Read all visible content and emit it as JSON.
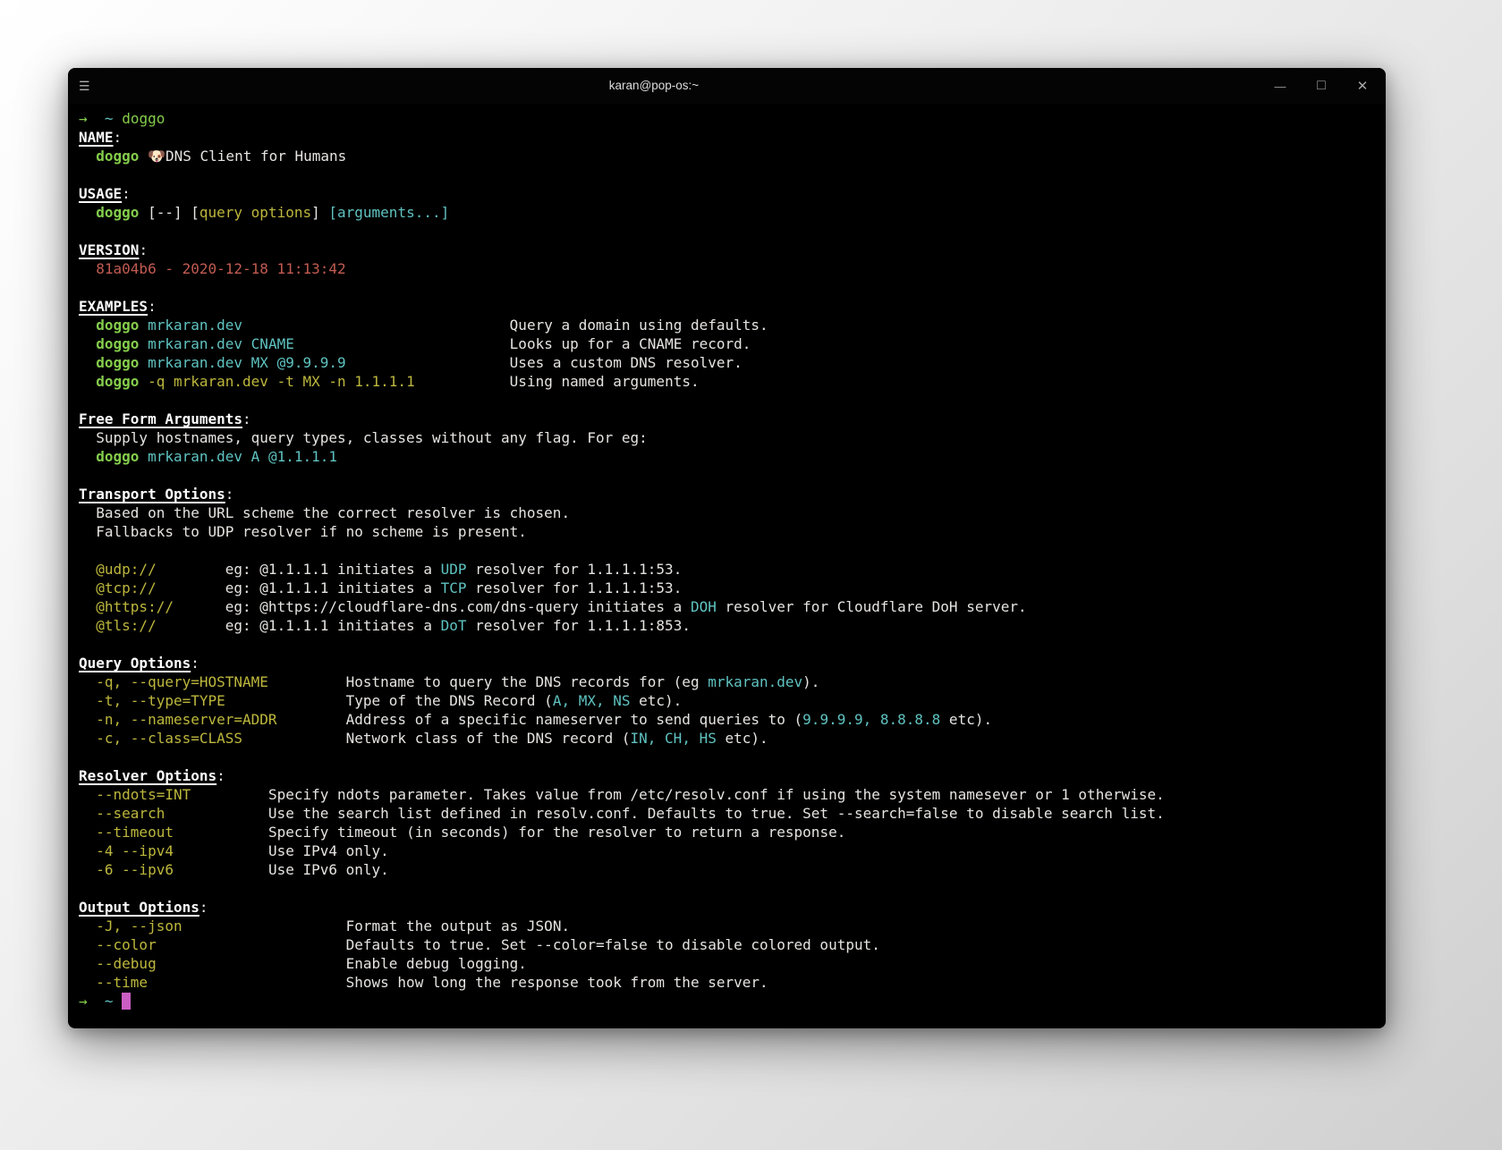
{
  "window": {
    "title": "karan@pop-os:~",
    "menu_icon": "☰",
    "minimize_icon": "—",
    "maximize_icon": "□",
    "close_icon": "✕"
  },
  "colors": {
    "terminal_bg": "#000000",
    "titlebar_bg": "#040404",
    "fg": "#e6e4e1",
    "header": "#fcfcfc",
    "green": "#84cc4c",
    "cyan": "#5fc3c1",
    "yellow": "#bdb73d",
    "red": "#c25b52",
    "magenta": "#cb5ec3"
  },
  "terminal": {
    "lines": [
      [
        [
          "→",
          "g"
        ],
        [
          "  ",
          ""
        ],
        [
          "~",
          "c"
        ],
        [
          " ",
          ""
        ],
        [
          "doggo",
          "g"
        ]
      ],
      [
        [
          "NAME",
          "h"
        ],
        [
          ":",
          ""
        ]
      ],
      [
        [
          "  ",
          ""
        ],
        [
          "doggo",
          "gb"
        ],
        [
          " ",
          ""
        ],
        [
          "🐶",
          "e"
        ],
        [
          "DNS Client for Humans",
          ""
        ]
      ],
      [],
      [
        [
          "USAGE",
          "h"
        ],
        [
          ":",
          ""
        ]
      ],
      [
        [
          "  ",
          ""
        ],
        [
          "doggo",
          "gb"
        ],
        [
          " [--] [",
          ""
        ],
        [
          "query options",
          "y"
        ],
        [
          "] ",
          ""
        ],
        [
          "[arguments...]",
          "c"
        ]
      ],
      [],
      [
        [
          "VERSION",
          "h"
        ],
        [
          ":",
          ""
        ]
      ],
      [
        [
          "  81a04b6 - 2020-12-18 11:13:42",
          "r"
        ]
      ],
      [],
      [
        [
          "EXAMPLES",
          "h"
        ],
        [
          ":",
          ""
        ]
      ],
      [
        [
          "  ",
          ""
        ],
        [
          "doggo",
          "gb"
        ],
        [
          " ",
          ""
        ],
        [
          "mrkaran.dev",
          "c"
        ],
        [
          "                               ",
          ""
        ],
        [
          "Query a domain using defaults.",
          ""
        ]
      ],
      [
        [
          "  ",
          ""
        ],
        [
          "doggo",
          "gb"
        ],
        [
          " ",
          ""
        ],
        [
          "mrkaran.dev CNAME",
          "c"
        ],
        [
          "                         ",
          ""
        ],
        [
          "Looks up for a CNAME record.",
          ""
        ]
      ],
      [
        [
          "  ",
          ""
        ],
        [
          "doggo",
          "gb"
        ],
        [
          " ",
          ""
        ],
        [
          "mrkaran.dev MX @9.9.9.9",
          "c"
        ],
        [
          "                   ",
          ""
        ],
        [
          "Uses a custom DNS resolver.",
          ""
        ]
      ],
      [
        [
          "  ",
          ""
        ],
        [
          "doggo",
          "gb"
        ],
        [
          " ",
          ""
        ],
        [
          "-q mrkaran.dev -t MX -n 1.1.1.1",
          "y"
        ],
        [
          "           ",
          ""
        ],
        [
          "Using named arguments.",
          ""
        ]
      ],
      [],
      [
        [
          "Free Form Arguments",
          "h"
        ],
        [
          ":",
          ""
        ]
      ],
      [
        [
          "  Supply hostnames, query types, classes without any flag. For eg:",
          ""
        ]
      ],
      [
        [
          "  ",
          ""
        ],
        [
          "doggo",
          "gb"
        ],
        [
          " ",
          ""
        ],
        [
          "mrkaran.dev A @1.1.1.1",
          "c"
        ]
      ],
      [],
      [
        [
          "Transport Options",
          "h"
        ],
        [
          ":",
          ""
        ]
      ],
      [
        [
          "  Based on the URL scheme the correct resolver is chosen.",
          ""
        ]
      ],
      [
        [
          "  Fallbacks to UDP resolver if no scheme is present.",
          ""
        ]
      ],
      [],
      [
        [
          "  ",
          ""
        ],
        [
          "@udp://",
          "y"
        ],
        [
          "        ",
          ""
        ],
        [
          "eg: @1.1.1.1 initiates a ",
          ""
        ],
        [
          "UDP",
          "c"
        ],
        [
          " resolver for 1.1.1.1:53.",
          ""
        ]
      ],
      [
        [
          "  ",
          ""
        ],
        [
          "@tcp://",
          "y"
        ],
        [
          "        ",
          ""
        ],
        [
          "eg: @1.1.1.1 initiates a ",
          ""
        ],
        [
          "TCP",
          "c"
        ],
        [
          " resolver for 1.1.1.1:53.",
          ""
        ]
      ],
      [
        [
          "  ",
          ""
        ],
        [
          "@https://",
          "y"
        ],
        [
          "      ",
          ""
        ],
        [
          "eg: @https://cloudflare-dns.com/dns-query initiates a ",
          ""
        ],
        [
          "DOH",
          "c"
        ],
        [
          " resolver for Cloudflare DoH server.",
          ""
        ]
      ],
      [
        [
          "  ",
          ""
        ],
        [
          "@tls://",
          "y"
        ],
        [
          "        ",
          ""
        ],
        [
          "eg: @1.1.1.1 initiates a ",
          ""
        ],
        [
          "DoT",
          "c"
        ],
        [
          " resolver for 1.1.1.1:853.",
          ""
        ]
      ],
      [],
      [
        [
          "Query Options",
          "h"
        ],
        [
          ":",
          ""
        ]
      ],
      [
        [
          "  ",
          ""
        ],
        [
          "-q, --query=HOSTNAME",
          "y"
        ],
        [
          "         ",
          ""
        ],
        [
          "Hostname to query the DNS records for (eg ",
          ""
        ],
        [
          "mrkaran.dev",
          "c"
        ],
        [
          ").",
          ""
        ]
      ],
      [
        [
          "  ",
          ""
        ],
        [
          "-t, --type=TYPE",
          "y"
        ],
        [
          "              ",
          ""
        ],
        [
          "Type of the DNS Record (",
          ""
        ],
        [
          "A, MX, NS",
          "c"
        ],
        [
          " etc).",
          ""
        ]
      ],
      [
        [
          "  ",
          ""
        ],
        [
          "-n, --nameserver=ADDR",
          "y"
        ],
        [
          "        ",
          ""
        ],
        [
          "Address of a specific nameserver to send queries to (",
          ""
        ],
        [
          "9.9.9.9, 8.8.8.8",
          "c"
        ],
        [
          " etc).",
          ""
        ]
      ],
      [
        [
          "  ",
          ""
        ],
        [
          "-c, --class=CLASS",
          "y"
        ],
        [
          "            ",
          ""
        ],
        [
          "Network class of the DNS record (",
          ""
        ],
        [
          "IN, CH, HS",
          "c"
        ],
        [
          " etc).",
          ""
        ]
      ],
      [],
      [
        [
          "Resolver Options",
          "h"
        ],
        [
          ":",
          ""
        ]
      ],
      [
        [
          "  ",
          ""
        ],
        [
          "--ndots=INT",
          "y"
        ],
        [
          "         ",
          ""
        ],
        [
          "Specify ndots parameter. Takes value from /etc/resolv.conf if using the system namesever or 1 otherwise.",
          ""
        ]
      ],
      [
        [
          "  ",
          ""
        ],
        [
          "--search",
          "y"
        ],
        [
          "            ",
          ""
        ],
        [
          "Use the search list defined in resolv.conf. Defaults to true. Set --search=false to disable search list.",
          ""
        ]
      ],
      [
        [
          "  ",
          ""
        ],
        [
          "--timeout",
          "y"
        ],
        [
          "           ",
          ""
        ],
        [
          "Specify timeout (in seconds) for the resolver to return a response.",
          ""
        ]
      ],
      [
        [
          "  ",
          ""
        ],
        [
          "-4 --ipv4",
          "y"
        ],
        [
          "           ",
          ""
        ],
        [
          "Use IPv4 only.",
          ""
        ]
      ],
      [
        [
          "  ",
          ""
        ],
        [
          "-6 --ipv6",
          "y"
        ],
        [
          "           ",
          ""
        ],
        [
          "Use IPv6 only.",
          ""
        ]
      ],
      [],
      [
        [
          "Output Options",
          "h"
        ],
        [
          ":",
          ""
        ]
      ],
      [
        [
          "  ",
          ""
        ],
        [
          "-J, --json",
          "y"
        ],
        [
          "                   ",
          ""
        ],
        [
          "Format the output as JSON.",
          ""
        ]
      ],
      [
        [
          "  ",
          ""
        ],
        [
          "--color",
          "y"
        ],
        [
          "                      ",
          ""
        ],
        [
          "Defaults to true. Set --color=false to disable colored output.",
          ""
        ]
      ],
      [
        [
          "  ",
          ""
        ],
        [
          "--debug",
          "y"
        ],
        [
          "                      ",
          ""
        ],
        [
          "Enable debug logging.",
          ""
        ]
      ],
      [
        [
          "  ",
          ""
        ],
        [
          "--time",
          "y"
        ],
        [
          "                       ",
          ""
        ],
        [
          "Shows how long the response took from the server.",
          ""
        ]
      ],
      [
        [
          "→",
          "g"
        ],
        [
          "  ",
          ""
        ],
        [
          "~",
          "c"
        ],
        [
          " ",
          ""
        ],
        [
          "",
          "cur"
        ]
      ]
    ]
  }
}
